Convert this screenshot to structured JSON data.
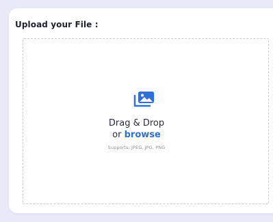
{
  "upload": {
    "title": "Upload your File :",
    "drag_text": "Drag & Drop",
    "or_text": "or",
    "browse_label": "browse",
    "supports_text": "Supports: JPEG, JPG, PNG"
  },
  "colors": {
    "accent": "#2f6fd6",
    "background": "#e8eaf8",
    "card": "#ffffff",
    "dashed_border": "#c9cbd3"
  },
  "icons": {
    "upload": "image-gallery-icon"
  }
}
